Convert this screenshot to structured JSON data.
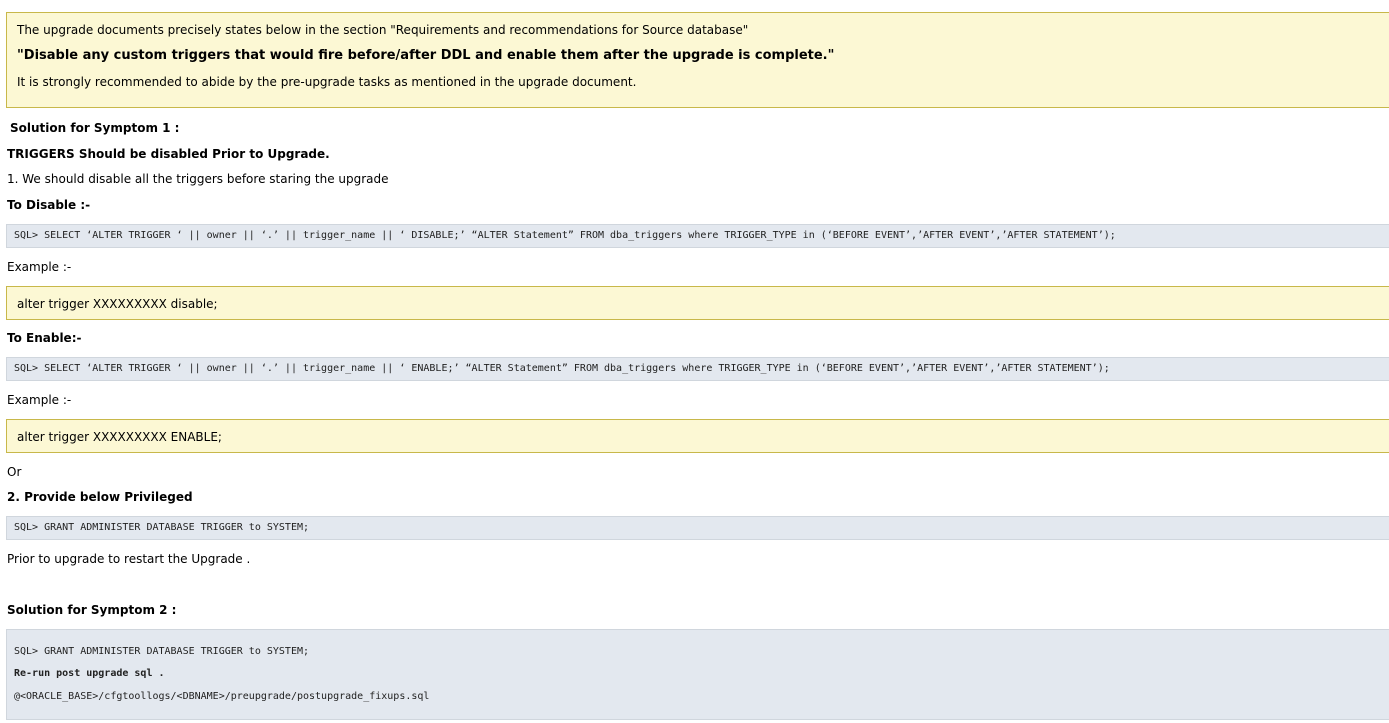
{
  "intro_box": {
    "line1": "The upgrade documents precisely states below in the section \"Requirements and recommendations for Source database\"",
    "line2": "\"Disable any custom triggers that would fire before/after DDL and enable them after the upgrade is complete.\"",
    "line3": "It is strongly recommended to abide by the pre-upgrade tasks as mentioned in the upgrade document."
  },
  "symptom1": {
    "heading": "Solution for Symptom 1 :",
    "subheading": "TRIGGERS Should be disabled Prior to Upgrade.",
    "step1": "1. We should disable all the triggers before staring the upgrade",
    "disable_label": "To Disable :-",
    "disable_sql": "SQL> SELECT ‘ALTER TRIGGER ‘ || owner || ‘.’ || trigger_name || ‘ DISABLE;’ “ALTER Statement” FROM dba_triggers where TRIGGER_TYPE in (‘BEFORE EVENT’,’AFTER EVENT’,’AFTER STATEMENT’);",
    "example_label_1": "Example :-",
    "disable_example": "alter trigger XXXXXXXXX disable;",
    "enable_label": "To Enable:-",
    "enable_sql": "SQL> SELECT ‘ALTER TRIGGER ‘ || owner || ‘.’ || trigger_name || ‘ ENABLE;’ “ALTER Statement” FROM dba_triggers where TRIGGER_TYPE in (‘BEFORE EVENT’,’AFTER EVENT’,’AFTER STATEMENT’);",
    "example_label_2": "Example :-",
    "enable_example": "alter trigger XXXXXXXXX ENABLE;",
    "or_text": "Or",
    "step2": "2. Provide below Privileged",
    "grant_sql": "SQL> GRANT ADMINISTER DATABASE TRIGGER to SYSTEM;",
    "prior_text": "Prior to upgrade to restart the Upgrade ."
  },
  "symptom2": {
    "heading": "Solution for Symptom 2 :",
    "code_line1": "SQL> GRANT ADMINISTER DATABASE TRIGGER to SYSTEM;",
    "code_line2": "Re-run post upgrade sql .",
    "code_line3": "@<ORACLE_BASE>/cfgtoollogs/<DBNAME>/preupgrade/postupgrade_fixups.sql"
  }
}
